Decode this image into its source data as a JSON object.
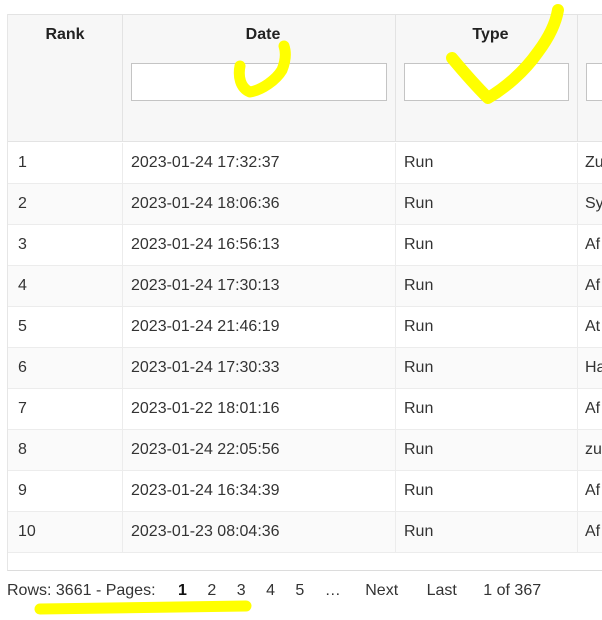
{
  "columns": {
    "rank": "Rank",
    "date": "Date",
    "type": "Type"
  },
  "filters": {
    "date_value": "",
    "type_value": "",
    "desc_value": ""
  },
  "rows": [
    {
      "rank": "1",
      "date": "2023-01-24 17:32:37",
      "type": "Run",
      "desc": "Zu"
    },
    {
      "rank": "2",
      "date": "2023-01-24 18:06:36",
      "type": "Run",
      "desc": "Sy"
    },
    {
      "rank": "3",
      "date": "2023-01-24 16:56:13",
      "type": "Run",
      "desc": "Af"
    },
    {
      "rank": "4",
      "date": "2023-01-24 17:30:13",
      "type": "Run",
      "desc": "Af"
    },
    {
      "rank": "5",
      "date": "2023-01-24 21:46:19",
      "type": "Run",
      "desc": "At"
    },
    {
      "rank": "6",
      "date": "2023-01-24 17:30:33",
      "type": "Run",
      "desc": "Ha"
    },
    {
      "rank": "7",
      "date": "2023-01-22 18:01:16",
      "type": "Run",
      "desc": "Af"
    },
    {
      "rank": "8",
      "date": "2023-01-24 22:05:56",
      "type": "Run",
      "desc": "zu"
    },
    {
      "rank": "9",
      "date": "2023-01-24 16:34:39",
      "type": "Run",
      "desc": "Af"
    },
    {
      "rank": "10",
      "date": "2023-01-23 08:04:36",
      "type": "Run",
      "desc": "Af"
    }
  ],
  "pager": {
    "summary": "Rows: 3661 - Pages:",
    "pages": [
      "1",
      "2",
      "3",
      "4",
      "5"
    ],
    "ellipsis": "…",
    "next": "Next",
    "last": "Last",
    "info": "1 of 367"
  },
  "colors": {
    "highlighter": "#ffff00",
    "header_bg": "#f7f7f7"
  }
}
